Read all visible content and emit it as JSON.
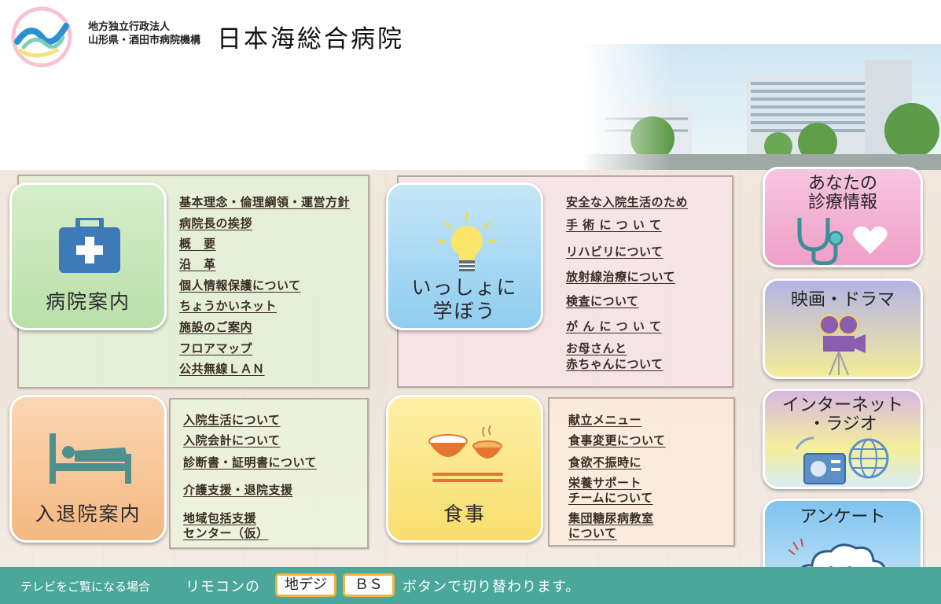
{
  "header": {
    "org_sub_line1": "地方独立行政法人",
    "org_sub_line2": "山形県・酒田市病院機構",
    "org_name": "日本海総合病院"
  },
  "hospital_info": {
    "tile_label": "病院案内",
    "links": [
      "基本理念・倫理綱領・運営方針",
      "病院長の挨拶",
      "概　要",
      "沿　革",
      "個人情報保護について",
      "ちょうかいネット",
      "施設のご案内",
      "フロアマップ",
      "公共無線ＬＡＮ"
    ]
  },
  "learn": {
    "tile_label_line1": "いっしょに",
    "tile_label_line2": "学ぼう",
    "links": [
      "安全な入院生活のため",
      "手 術 に つ い て",
      "リハビリについて",
      "放射線治療について",
      "検査について",
      "が ん に つ い て",
      "お母さんと",
      "赤ちゃんについて"
    ]
  },
  "admission": {
    "tile_label": "入退院案内",
    "links": [
      "入院生活について",
      "入院会計について",
      "診断書・証明書について",
      "介護支援・退院支援",
      "地域包括支援",
      "センター（仮）"
    ]
  },
  "meals": {
    "tile_label": "食事",
    "links": [
      "献立メニュー",
      "食事変更について",
      "食欲不振時に",
      "栄養サポート",
      "チームについて",
      "集団糖尿病教室",
      "について"
    ]
  },
  "side": {
    "medical_info_line1": "あなたの",
    "medical_info_line2": "診療情報",
    "movies": "映画・ドラマ",
    "internet_line1": "インターネット",
    "internet_line2": "・ラジオ",
    "survey": "アンケート"
  },
  "footer": {
    "text1": "テレビをご覧になる場合",
    "text2": "リモコンの",
    "key1": "地デジ",
    "key2": "ＢＳ",
    "text3": "ボタンで切り替わります。"
  },
  "colors": {
    "footer_bg": "#4aa79a",
    "hospital_tile": "#c9e6bd",
    "learn_tile": "#9fd4f0",
    "admission_tile": "#f7c59a",
    "meals_tile": "#fbe88c",
    "key_border": "#f0b43a"
  },
  "icons": [
    "hospital-building-icon",
    "lightbulb-icon",
    "bed-patient-icon",
    "rice-bowl-icon",
    "stethoscope-heart-icon",
    "film-camera-icon",
    "radio-globe-icon",
    "cloud-face-icon"
  ]
}
